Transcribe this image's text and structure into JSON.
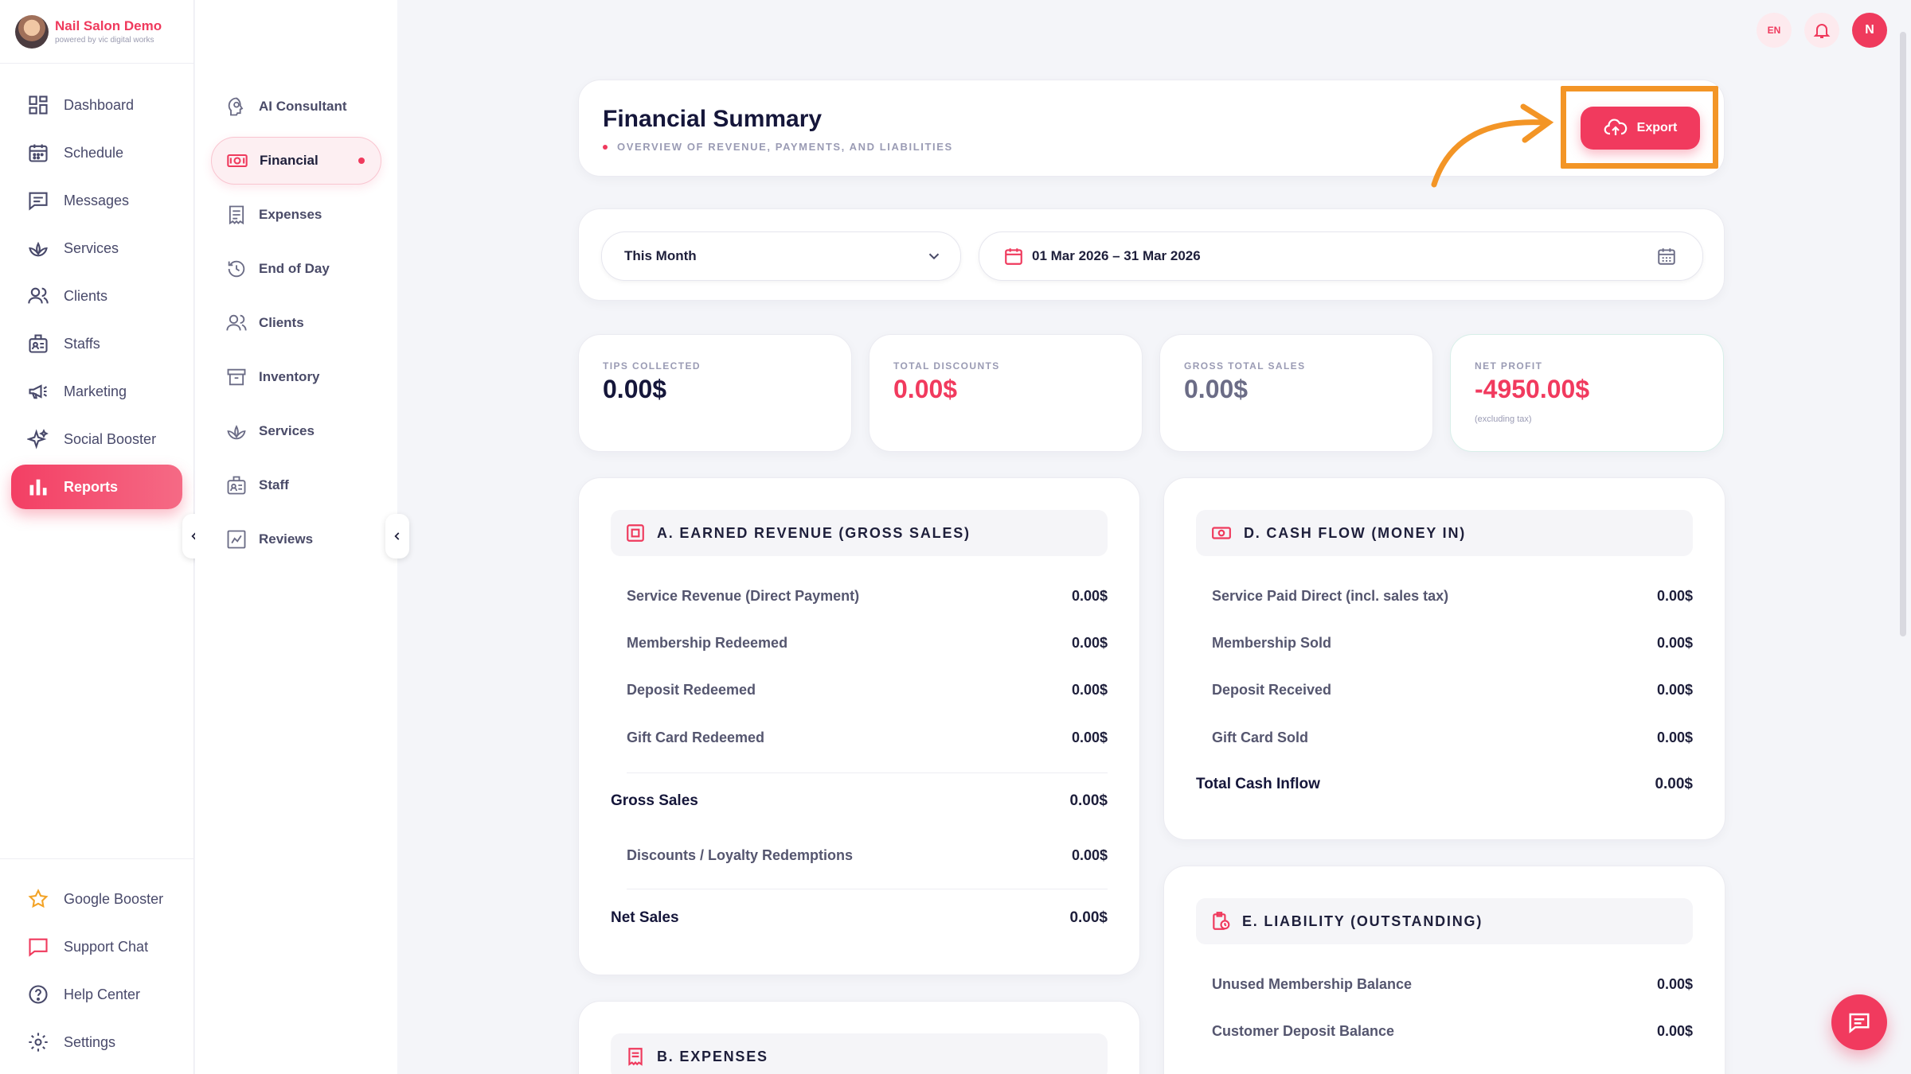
{
  "brand": {
    "name": "Nail Salon Demo",
    "tagline": "powered by vic digital works"
  },
  "sidebar": {
    "items": [
      {
        "label": "Dashboard",
        "icon": "dashboard-icon"
      },
      {
        "label": "Schedule",
        "icon": "calendar-icon"
      },
      {
        "label": "Messages",
        "icon": "message-icon"
      },
      {
        "label": "Services",
        "icon": "lotus-icon"
      },
      {
        "label": "Clients",
        "icon": "users-icon"
      },
      {
        "label": "Staffs",
        "icon": "staff-icon"
      },
      {
        "label": "Marketing",
        "icon": "megaphone-icon"
      },
      {
        "label": "Social Booster",
        "icon": "sparkle-icon"
      },
      {
        "label": "Reports",
        "icon": "bar-chart-icon",
        "active": true
      }
    ],
    "bottom_items": [
      {
        "label": "Google Booster",
        "icon": "star-icon"
      },
      {
        "label": "Support Chat",
        "icon": "chat-icon"
      },
      {
        "label": "Help Center",
        "icon": "help-icon"
      },
      {
        "label": "Settings",
        "icon": "gear-icon"
      }
    ]
  },
  "subnav": {
    "items": [
      {
        "label": "AI Consultant"
      },
      {
        "label": "Financial",
        "active": true
      },
      {
        "label": "Expenses"
      },
      {
        "label": "End of Day"
      },
      {
        "label": "Clients"
      },
      {
        "label": "Inventory"
      },
      {
        "label": "Services"
      },
      {
        "label": "Staff"
      },
      {
        "label": "Reviews"
      }
    ]
  },
  "topbar": {
    "lang": "EN",
    "avatar": "N"
  },
  "header": {
    "title": "Financial Summary",
    "subtitle": "OVERVIEW OF REVENUE, PAYMENTS, AND LIABILITIES",
    "export_label": "Export"
  },
  "filters": {
    "period": "This Month",
    "date_range": "01 Mar 2026 – 31 Mar 2026"
  },
  "stats": [
    {
      "label": "TIPS COLLECTED",
      "value": "0.00$",
      "color": "#15163a"
    },
    {
      "label": "TOTAL DISCOUNTS",
      "value": "0.00$",
      "color": "#f13a5e"
    },
    {
      "label": "GROSS TOTAL SALES",
      "value": "0.00$",
      "color": "#6b6c86"
    },
    {
      "label": "NET PROFIT",
      "value": "-4950.00$",
      "color": "#f13a5e",
      "note": "(excluding tax)"
    }
  ],
  "earned_revenue": {
    "title": "A. EARNED REVENUE (GROSS SALES)",
    "rows": [
      {
        "label": "Service Revenue (Direct Payment)",
        "value": "0.00$"
      },
      {
        "label": "Membership Redeemed",
        "value": "0.00$"
      },
      {
        "label": "Deposit Redeemed",
        "value": "0.00$"
      },
      {
        "label": "Gift Card Redeemed",
        "value": "0.00$"
      }
    ],
    "gross_sales": {
      "label": "Gross Sales",
      "value": "0.00$"
    },
    "discounts": {
      "label": "Discounts / Loyalty Redemptions",
      "value": "0.00$"
    },
    "net_sales": {
      "label": "Net Sales",
      "value": "0.00$"
    }
  },
  "expenses": {
    "title": "B. EXPENSES"
  },
  "cash_flow": {
    "title": "D. CASH FLOW (MONEY IN)",
    "rows": [
      {
        "label": "Service Paid Direct (incl. sales tax)",
        "value": "0.00$"
      },
      {
        "label": "Membership Sold",
        "value": "0.00$"
      },
      {
        "label": "Deposit Received",
        "value": "0.00$"
      },
      {
        "label": "Gift Card Sold",
        "value": "0.00$"
      }
    ],
    "total": {
      "label": "Total Cash Inflow",
      "value": "0.00$"
    }
  },
  "liability": {
    "title": "E. LIABILITY (OUTSTANDING)",
    "rows": [
      {
        "label": "Unused Membership Balance",
        "value": "0.00$"
      },
      {
        "label": "Customer Deposit Balance",
        "value": "0.00$"
      }
    ]
  },
  "colors": {
    "accent": "#f13a5e",
    "highlight": "#f39526"
  }
}
